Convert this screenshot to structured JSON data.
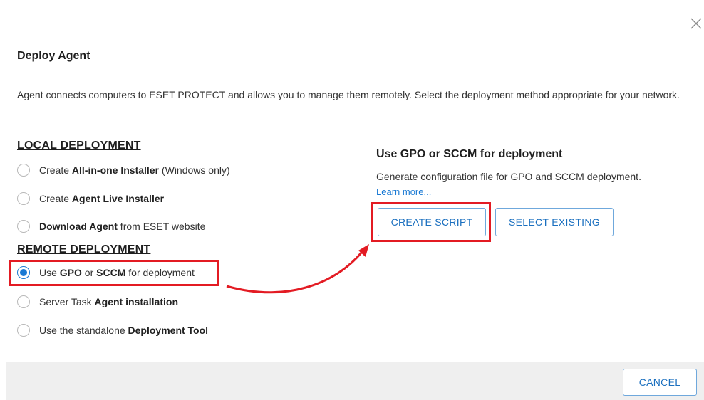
{
  "dialog": {
    "title": "Deploy Agent",
    "description": "Agent connects computers to ESET PROTECT and allows you to manage them remotely. Select the deployment method appropriate for your network."
  },
  "local": {
    "heading": "LOCAL DEPLOYMENT",
    "options": [
      {
        "pre": "Create ",
        "bold": "All-in-one Installer",
        "post": " (Windows only)"
      },
      {
        "pre": "Create ",
        "bold": "Agent Live Installer",
        "post": ""
      },
      {
        "pre": "",
        "bold": "Download Agent",
        "post": " from ESET website"
      }
    ]
  },
  "remote": {
    "heading": "REMOTE DEPLOYMENT",
    "gpo_option": {
      "pre": "Use ",
      "bold1": "GPO",
      "mid": " or ",
      "bold2": "SCCM",
      "post": " for deployment"
    },
    "options": [
      {
        "pre": "Server Task ",
        "bold": "Agent installation",
        "post": ""
      },
      {
        "pre": "Use the standalone ",
        "bold": "Deployment Tool",
        "post": ""
      }
    ]
  },
  "panel": {
    "title": "Use GPO or SCCM for deployment",
    "description": "Generate configuration file for GPO and SCCM deployment.",
    "learn_more": "Learn more...",
    "create_script": "CREATE SCRIPT",
    "select_existing": "SELECT EXISTING"
  },
  "footer": {
    "cancel": "CANCEL"
  },
  "icons": {
    "close": "close-icon"
  },
  "colors": {
    "accent": "#1a7ad4",
    "highlight": "#e31b23",
    "footer_bg": "#efefef"
  }
}
